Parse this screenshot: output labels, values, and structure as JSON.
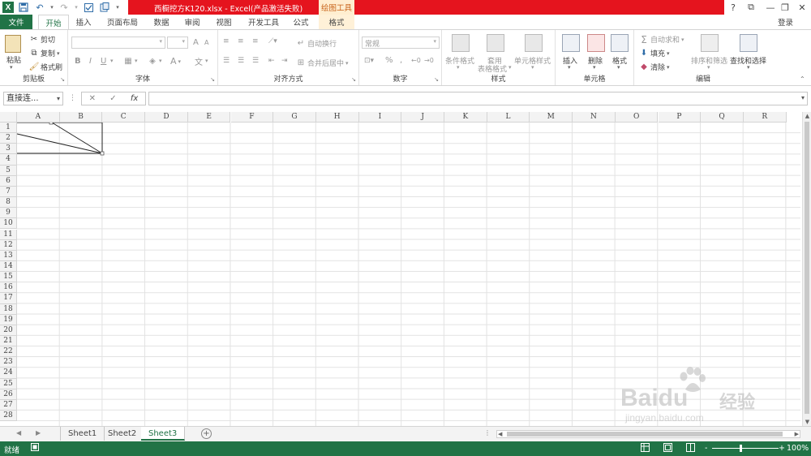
{
  "titlebar": {
    "app_logo": "X",
    "doc_title": "西橱挖方K120.xlsx -  Excel(产品激活失败)",
    "context_tab": "绘图工具",
    "controls": [
      "?",
      "⧉",
      "—",
      "❐",
      "✕"
    ]
  },
  "tabs": {
    "file": "文件",
    "items": [
      "开始",
      "插入",
      "页面布局",
      "数据",
      "审阅",
      "视图",
      "开发工具",
      "公式",
      "格式"
    ],
    "active": "开始",
    "login": "登录"
  },
  "ribbon": {
    "clipboard": {
      "label": "剪贴板",
      "paste": "粘贴",
      "cut": "剪切",
      "copy": "复制",
      "format_painter": "格式刷"
    },
    "font": {
      "label": "字体",
      "bold": "B",
      "italic": "I",
      "underline": "U",
      "grow": "A",
      "shrink": "A"
    },
    "alignment": {
      "label": "对齐方式",
      "wrap": "自动换行",
      "merge": "合并后居中"
    },
    "number": {
      "label": "数字",
      "format": "常规",
      "percent": "%",
      "comma": ","
    },
    "styles": {
      "label": "样式",
      "conditional": "条件格式",
      "table1": "套用",
      "table2": "表格格式",
      "cell_styles": "单元格样式"
    },
    "cells": {
      "label": "单元格",
      "insert": "插入",
      "delete": "删除",
      "format": "格式"
    },
    "editing": {
      "label": "编辑",
      "autosum": "自动求和",
      "fill": "填充",
      "clear": "清除",
      "sort": "排序和筛选",
      "find": "查找和选择"
    }
  },
  "formula_bar": {
    "name_box": "直接连...",
    "cancel": "✕",
    "enter": "✓",
    "fx": "fx",
    "value": ""
  },
  "grid": {
    "columns": [
      "A",
      "B",
      "C",
      "D",
      "E",
      "F",
      "G",
      "H",
      "I",
      "J",
      "K",
      "L",
      "M",
      "N",
      "O",
      "P",
      "Q",
      "R"
    ],
    "rows": [
      "1",
      "2",
      "3",
      "4",
      "5",
      "6",
      "7",
      "8",
      "9",
      "10",
      "11",
      "12",
      "13",
      "14",
      "15",
      "16",
      "17",
      "18",
      "19",
      "20",
      "21",
      "22",
      "23",
      "24",
      "25",
      "26",
      "27",
      "28"
    ]
  },
  "sheets": {
    "tabs": [
      "Sheet1",
      "Sheet2",
      "Sheet3"
    ],
    "active": "Sheet3",
    "add": "+"
  },
  "status": {
    "ready": "就绪",
    "zoom": "100%",
    "minus": "-",
    "plus": "+"
  },
  "watermark": {
    "brand": "Baidu",
    "cn": "经验",
    "url": "jingyan.baidu.com"
  }
}
